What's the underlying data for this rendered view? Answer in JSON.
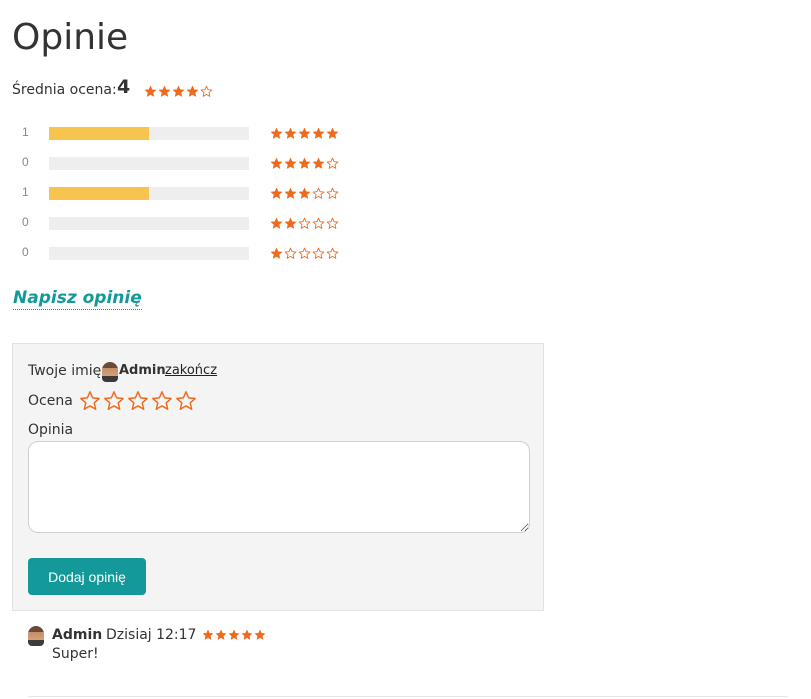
{
  "header": {
    "title": "Opinie"
  },
  "average": {
    "label": "Średnia ocena:",
    "value": "4",
    "stars": 4
  },
  "histogram": [
    {
      "count": "1",
      "stars": 5,
      "fraction": 0.5
    },
    {
      "count": "0",
      "stars": 4,
      "fraction": 0
    },
    {
      "count": "1",
      "stars": 3,
      "fraction": 0.5
    },
    {
      "count": "0",
      "stars": 2,
      "fraction": 0
    },
    {
      "count": "0",
      "stars": 1,
      "fraction": 0
    }
  ],
  "write_link": "Napisz opinię",
  "form": {
    "name_label": "Twoje imię",
    "user": "Admin",
    "logout": "zakończ",
    "rating_label": "Ocena",
    "rating_value": 0,
    "opinion_label": "Opinia",
    "opinion_value": "",
    "submit": "Dodaj opinię"
  },
  "reviews": [
    {
      "author": "Admin",
      "date": "Dzisiaj 12:17",
      "stars": 5,
      "text": "Super!"
    }
  ],
  "colors": {
    "star": "#f06a1e",
    "bar": "#f6c44f",
    "accent": "#14999a"
  },
  "icons": {
    "star_full": "star-filled-icon",
    "star_empty": "star-empty-icon",
    "avatar": "avatar"
  }
}
